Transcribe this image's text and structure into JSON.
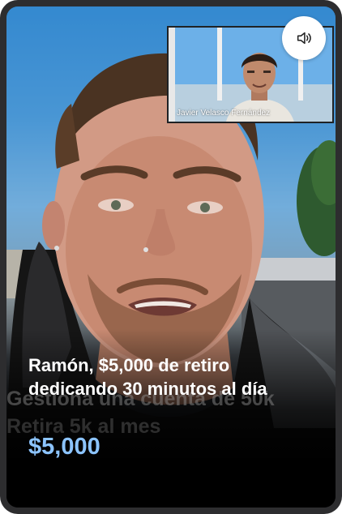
{
  "card": {
    "headline_line1": "Ramón, $5,000 de retiro",
    "headline_line2": "dedicando 30 minutos al día",
    "amount": "$5,000",
    "burned_caption_line1": "Gestiona una cuenta de 50k",
    "burned_caption_line2": "Retira 5k al mes"
  },
  "pip": {
    "name": "Javier Velasco Fernández"
  },
  "controls": {
    "sound_icon": "speaker-icon"
  },
  "colors": {
    "amount": "#8cc4ff",
    "headline": "#ffffff",
    "frame": "#2d2d2f"
  }
}
